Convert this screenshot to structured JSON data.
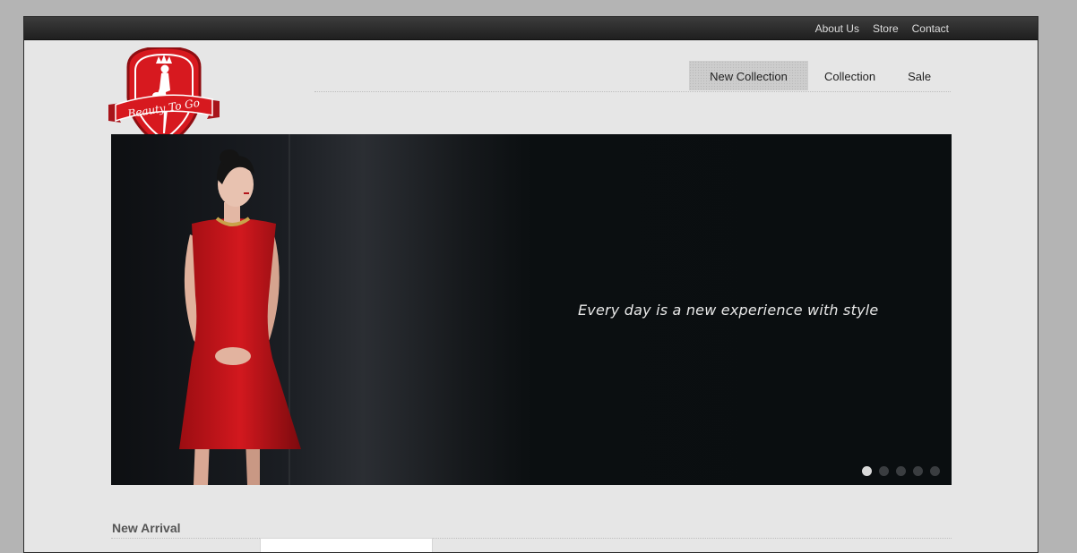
{
  "top_links": [
    "About Us",
    "Store",
    "Contact"
  ],
  "logo": {
    "text": "Beauty To Go",
    "colors": {
      "red": "#d7191f",
      "dark_red": "#8f0e12",
      "white": "#ffffff"
    }
  },
  "main_nav": [
    {
      "label": "New Collection",
      "active": true
    },
    {
      "label": "Collection",
      "active": false
    },
    {
      "label": "Sale",
      "active": false
    }
  ],
  "hero": {
    "tagline": "Every day is a new experience with style",
    "slides": 5,
    "active_slide": 1,
    "dress_color": "#c4141a"
  },
  "section": {
    "title": "New Arrival"
  }
}
